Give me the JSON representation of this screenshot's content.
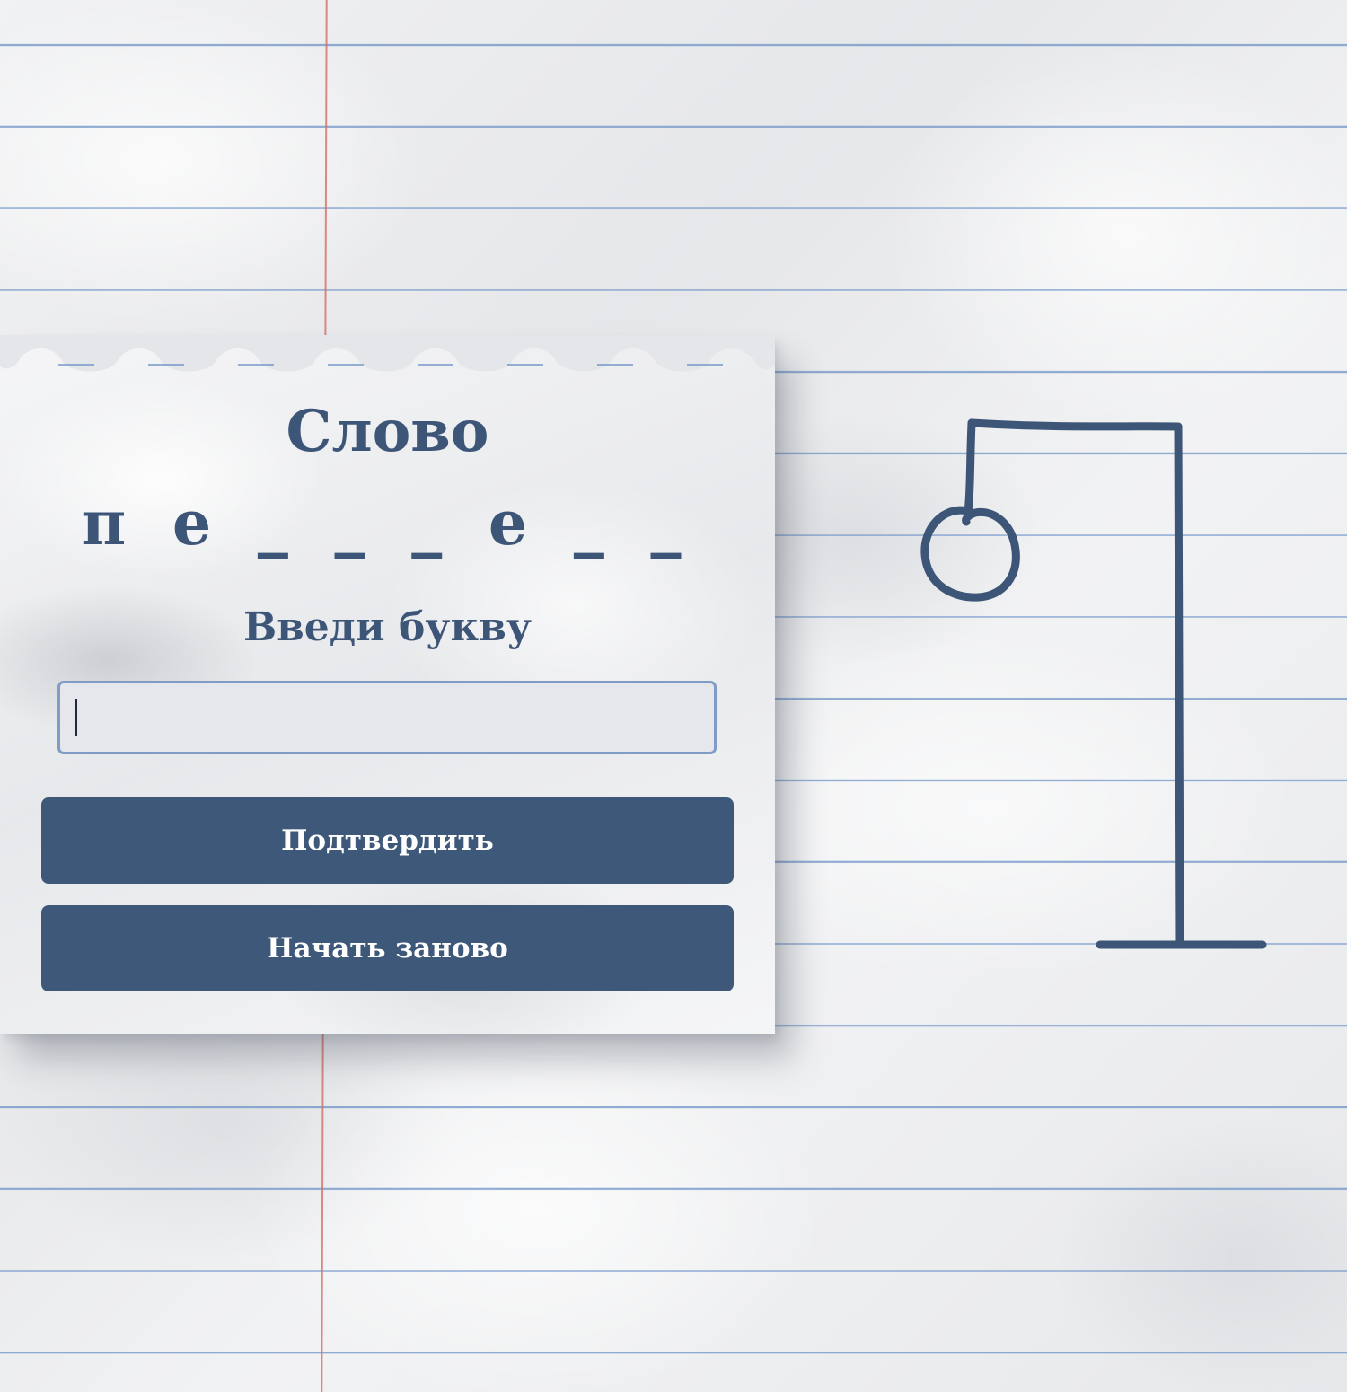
{
  "game": {
    "title": "Слово",
    "word_mask": "п е _ _ _ е _ _",
    "prompt": "Введи букву",
    "input": {
      "value": "",
      "placeholder": ""
    },
    "buttons": {
      "confirm_label": "Подтвердить",
      "restart_label": "Начать заново"
    },
    "hangman_stage": "gallows-and-head"
  },
  "colors": {
    "ink": "#3d5678",
    "button": "#3e5879",
    "button_text": "#ffffff",
    "input_border": "#7f9cc6",
    "input_bg": "#e5e7ec",
    "rule_line": "#6c92c6",
    "margin_line": "#d46e64"
  }
}
